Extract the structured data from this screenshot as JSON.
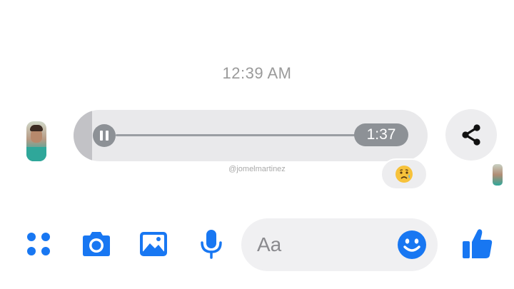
{
  "conversation": {
    "timestamp": "12:39 AM",
    "watermark": "@jomelmartinez"
  },
  "voice_message": {
    "duration": "1:37",
    "played_fraction": 0.0,
    "state_icon": "pause-icon",
    "bubble_color": "#e9e9eb",
    "control_color": "#8d9196"
  },
  "reaction": {
    "emoji": "😥"
  },
  "share": {
    "icon": "share-icon"
  },
  "composer": {
    "placeholder": "Aa",
    "icons": [
      "menu-dots-icon",
      "camera-icon",
      "gallery-icon",
      "microphone-icon",
      "emoji-icon",
      "thumbs-up-icon"
    ],
    "accent_color": "#1877f2",
    "input_bg": "#f0f0f2"
  }
}
